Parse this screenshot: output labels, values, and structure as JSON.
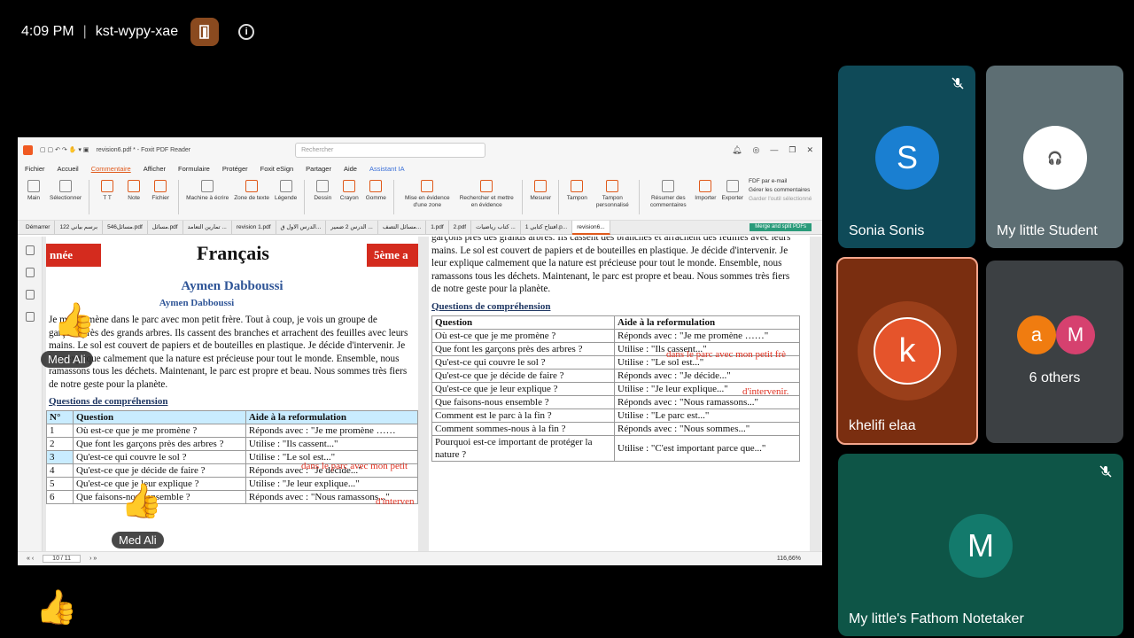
{
  "topbar": {
    "time": "4:09 PM",
    "meeting_code": "kst-wypy-xae"
  },
  "foxit": {
    "title": "revision6.pdf * - Foxit PDF Reader",
    "search_placeholder": "Rechercher",
    "menu": [
      "Fichier",
      "Accueil",
      "Commentaire",
      "Afficher",
      "Formulaire",
      "Protéger",
      "Foxit eSign",
      "Partager",
      "Aide",
      "Assistant IA"
    ],
    "ribbon": [
      {
        "label": "Main"
      },
      {
        "label": "Sélectionner"
      },
      {
        "label": "Note"
      },
      {
        "label": "Fichier"
      },
      {
        "label": "Machine à écrire"
      },
      {
        "label": "Zone de texte"
      },
      {
        "label": "Légende"
      },
      {
        "label": "Dessin"
      },
      {
        "label": "Crayon"
      },
      {
        "label": "Gomme"
      },
      {
        "label": "Mise en évidence d'une zone"
      },
      {
        "label": "Rechercher et mettre en évidence"
      },
      {
        "label": "Mesurer"
      },
      {
        "label": "Tampon"
      },
      {
        "label": "Tampon personnalisé"
      },
      {
        "label": "Résumer des commentaires"
      },
      {
        "label": "Importer"
      },
      {
        "label": "Exporter"
      }
    ],
    "ribbon_side": [
      "FDF par e-mail",
      "Gérer les commentaires",
      "Garder l'outil sélectionné"
    ],
    "tabs": [
      "Démarrer",
      "122 برسم بياني",
      "546مسائل.pdf",
      "مسائل.pdf",
      "تمارين التعامد ...",
      "revision 1.pdf",
      "الدرس الاول ق...",
      "الدرس 2 ضمير ...",
      "مسائل التصف...",
      "1.pdf",
      "2.pdf",
      "كتاب رياضيات ...",
      "افتتاح كتابي 1.p...",
      "revision6..."
    ],
    "merge_label": "Merge and split PDFs",
    "page_indicator": "10 / 11",
    "zoom": "116,66%"
  },
  "left_page": {
    "banner_left": "nnée",
    "banner_right": "5ème a",
    "title": "Français",
    "author_main": "Aymen Dabboussi",
    "author_sub": "Aymen Dabboussi",
    "paragraph": "Je me promène dans le parc avec mon petit frère. Tout à coup, je vois un groupe de garçons près des grands arbres. Ils cassent des branches et arrachent des feuilles avec leurs mains. Le sol est couvert de papiers et de bouteilles en plastique. Je décide d'intervenir. Je leur explique calmement que la nature est précieuse pour tout le monde. Ensemble, nous ramassons tous les déchets. Maintenant, le parc est propre et beau. Nous sommes très fiers de notre geste pour la planète.",
    "questions_heading": "Questions de compréhension",
    "table_headers": [
      "N°",
      "Question",
      "Aide à la reformulation"
    ],
    "rows": [
      [
        "1",
        "Où est-ce que je me promène ?",
        "Réponds avec : \"Je me promène ……"
      ],
      [
        "2",
        "Que font les garçons près des arbres ?",
        "Utilise : \"Ils cassent...\""
      ],
      [
        "3",
        "Qu'est-ce qui couvre le sol ?",
        "Utilise : \"Le sol est...\""
      ],
      [
        "4",
        "Qu'est-ce que je décide de faire ?",
        "Réponds avec : \"Je décide...\""
      ],
      [
        "5",
        "Qu'est-ce que je leur explique ?",
        "Utilise : \"Je leur explique...\""
      ],
      [
        "6",
        "Que faisons-nous ensemble ?",
        "Réponds avec : \"Nous ramassons...\""
      ]
    ],
    "red_note_1": "dans le parc avec mon petit",
    "red_note_2": "d'interven"
  },
  "right_page": {
    "paragraph": "garçons près des grands arbres. Ils cassent des branches et arrachent des feuilles avec leurs mains. Le sol est couvert de papiers et de bouteilles en plastique. Je décide d'intervenir. Je leur explique calmement que la nature est précieuse pour tout le monde. Ensemble, nous ramassons tous les déchets. Maintenant, le parc est propre et beau. Nous sommes très fiers de notre geste pour la planète.",
    "questions_heading": "Questions de compréhension",
    "table_headers": [
      "Question",
      "Aide à la reformulation"
    ],
    "rows": [
      [
        "Où est-ce que je me promène ?",
        "Réponds avec : \"Je me promène ……\""
      ],
      [
        "Que font les garçons près des arbres ?",
        "Utilise : \"Ils cassent...\""
      ],
      [
        "Qu'est-ce qui couvre le sol ?",
        "Utilise : \"Le sol est...\""
      ],
      [
        "Qu'est-ce que je décide de faire ?",
        "Réponds avec : \"Je décide...\""
      ],
      [
        "Qu'est-ce que je leur explique ?",
        "Utilise : \"Je leur explique...\""
      ],
      [
        "Que faisons-nous ensemble ?",
        "Réponds avec : \"Nous ramassons...\""
      ],
      [
        "Comment est le parc à la fin ?",
        "Utilise : \"Le parc est...\""
      ],
      [
        "Comment sommes-nous à la fin ?",
        "Réponds avec : \"Nous sommes...\""
      ],
      [
        "Pourquoi est-ce important de protéger la nature ?",
        "Utilise : \"C'est important parce que...\""
      ]
    ],
    "red_note_1": "dans le parc avec mon petit frè",
    "red_note_2": "d'intervenir."
  },
  "reactions": {
    "label": "Med Ali"
  },
  "participants": [
    {
      "name": "Sonia Sonis",
      "initial": "S",
      "color": "#1a7fd1",
      "bg": "#0f4a58",
      "muted": true
    },
    {
      "name": "My little Student",
      "initial": "",
      "color": "#ffffff",
      "bg": "#5d6e73",
      "muted": false
    },
    {
      "name": "khelifi elaa",
      "initial": "k",
      "color": "#e5542b",
      "bg": "#7a2e10",
      "muted": false
    },
    {
      "name": "6 others",
      "initial": "",
      "bg": "#3c4043"
    },
    {
      "name": "My little's Fathom Notetaker",
      "initial": "M",
      "color": "#137a6c",
      "bg": "#0e5547",
      "muted": true
    }
  ],
  "others_avatars": [
    {
      "initial": "a",
      "color": "#f07c10"
    },
    {
      "initial": "M",
      "color": "#d6416f"
    }
  ]
}
